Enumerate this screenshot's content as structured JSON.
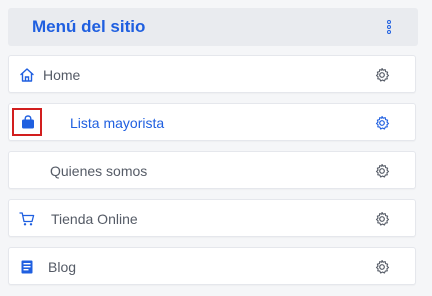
{
  "header": {
    "title": "Menú del sitio",
    "menu_icon": "vertical-ellipsis-icon"
  },
  "items": [
    {
      "label": "Home",
      "icon": "home-icon",
      "action_icon": "gear-icon",
      "active": false
    },
    {
      "label": "Lista mayorista",
      "icon": "bag-icon",
      "action_icon": "gear-icon",
      "active": true,
      "highlighted": true
    },
    {
      "label": "Quienes somos",
      "icon": "",
      "action_icon": "gear-icon",
      "active": false
    },
    {
      "label": "Tienda Online",
      "icon": "cart-icon",
      "action_icon": "gear-icon",
      "active": false
    },
    {
      "label": "Blog",
      "icon": "document-icon",
      "action_icon": "gear-icon",
      "active": false
    }
  ],
  "colors": {
    "accent": "#1f5fe0",
    "text": "#555b66",
    "highlight_border": "#d21e1e",
    "header_bg": "#e9ebef"
  }
}
